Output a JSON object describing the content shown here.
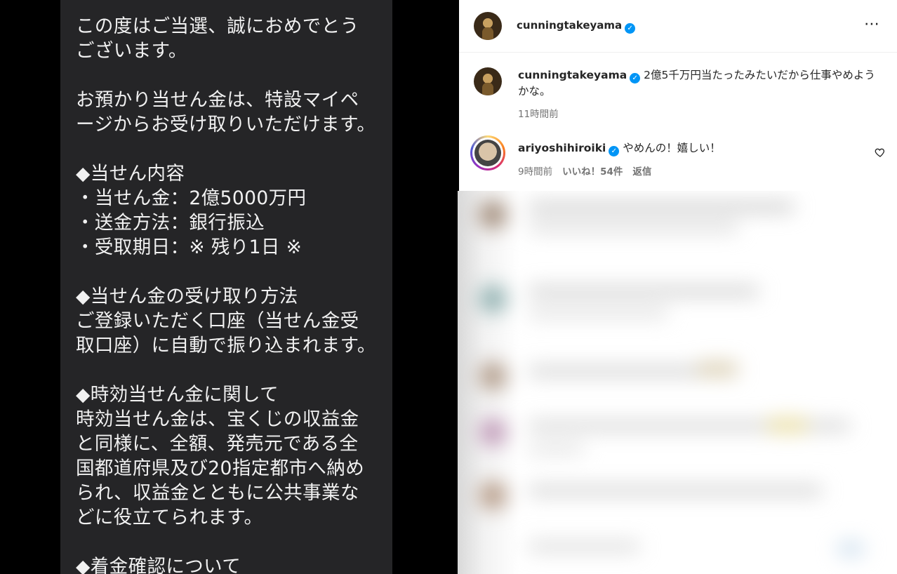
{
  "message": {
    "paragraphs": [
      "この度はご当選、誠におめでとう\nございます。",
      "お預かり当せん金は、特設マイペ\nージからお受け取りいただけます。",
      "◆当せん内容\n・当せん金：2億5000万円\n・送金方法：銀行振込\n・受取期日：※ 残り1日 ※",
      "◆当せん金の受け取り方法\nご登録いただく口座（当せん金受\n取口座）に自動で振り込まれます。",
      "◆時効当せん金に関して\n時効当せん金は、宝くじの収益金\nと同様に、全額、発売元である全\n国都道府県及び20指定都市へ納め\nられ、収益金とともに公共事業な\nどに役立てられます。",
      "◆着金確認について"
    ]
  },
  "instagram": {
    "header": {
      "username": "cunningtakeyama",
      "more_icon": "⋯"
    },
    "caption": {
      "username": "cunningtakeyama",
      "text": "2億5千万円当たったみたいだから仕事やめようかな。",
      "time": "11時間前"
    },
    "comment": {
      "username": "ariyoshihiroiki",
      "text": "やめんの！嬉しい！",
      "time": "9時間前",
      "likes": "いいね！54件",
      "reply": "返信"
    },
    "colors": {
      "verified": "#0095f6",
      "text": "#262626",
      "meta": "#737373"
    }
  }
}
